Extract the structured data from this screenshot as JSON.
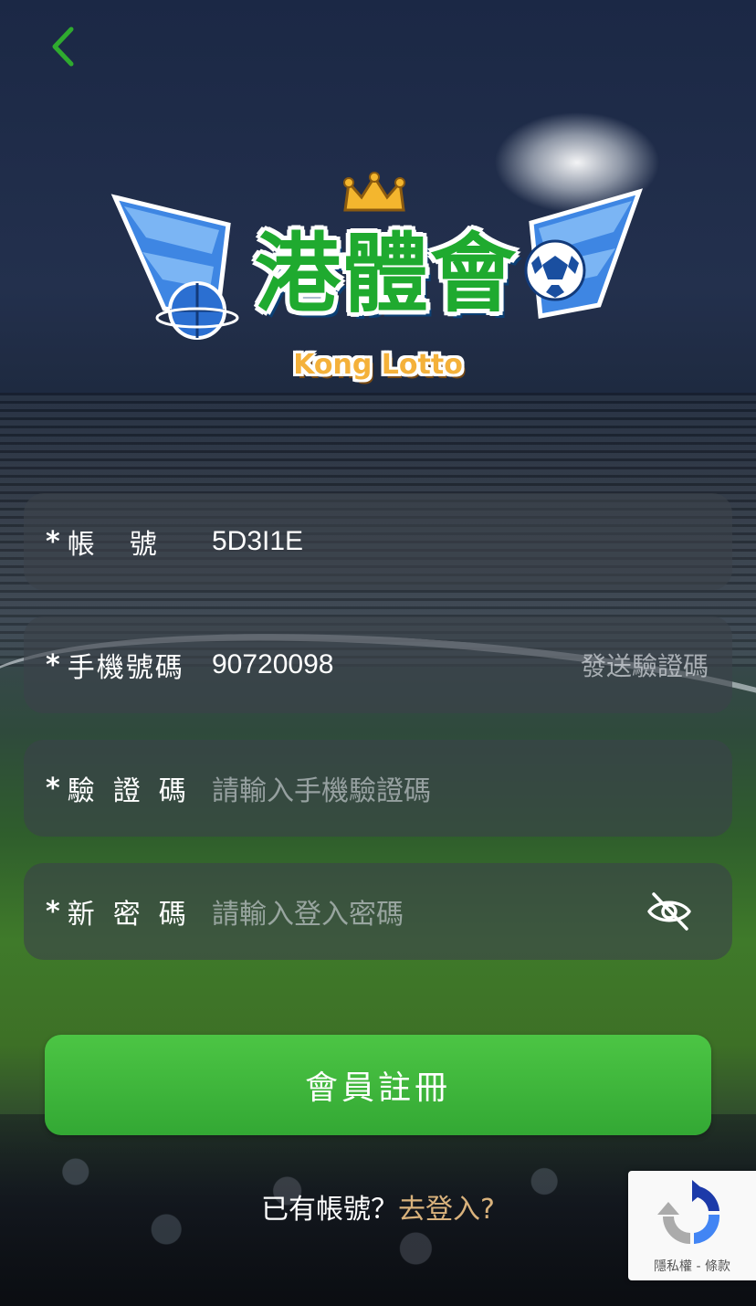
{
  "header": {
    "back_icon": "chevron-left-icon"
  },
  "logo": {
    "chinese": "港體會",
    "english": "Kong Lotto"
  },
  "form": {
    "required_mark": "*",
    "account": {
      "label": "帳號",
      "value": "5D3I1E"
    },
    "phone": {
      "label": "手機號碼",
      "value": "90720098",
      "send_code": "發送驗證碼"
    },
    "code": {
      "label": "驗證碼",
      "placeholder": "請輸入手機驗證碼"
    },
    "password": {
      "label": "新密碼",
      "placeholder": "請輸入登入密碼",
      "toggle_icon": "eye-off-icon"
    },
    "submit": "會員註冊"
  },
  "footer": {
    "has_account": "已有帳號？",
    "login_link": "去登入?"
  },
  "recaptcha": {
    "links": "隱私權 - 條款"
  },
  "colors": {
    "accent_green": "#3cb53b",
    "back_arrow": "#2faa2f",
    "link_gold": "#d9b27c",
    "logo_green": "#1faa2f",
    "logo_gold": "#f4b13a"
  }
}
